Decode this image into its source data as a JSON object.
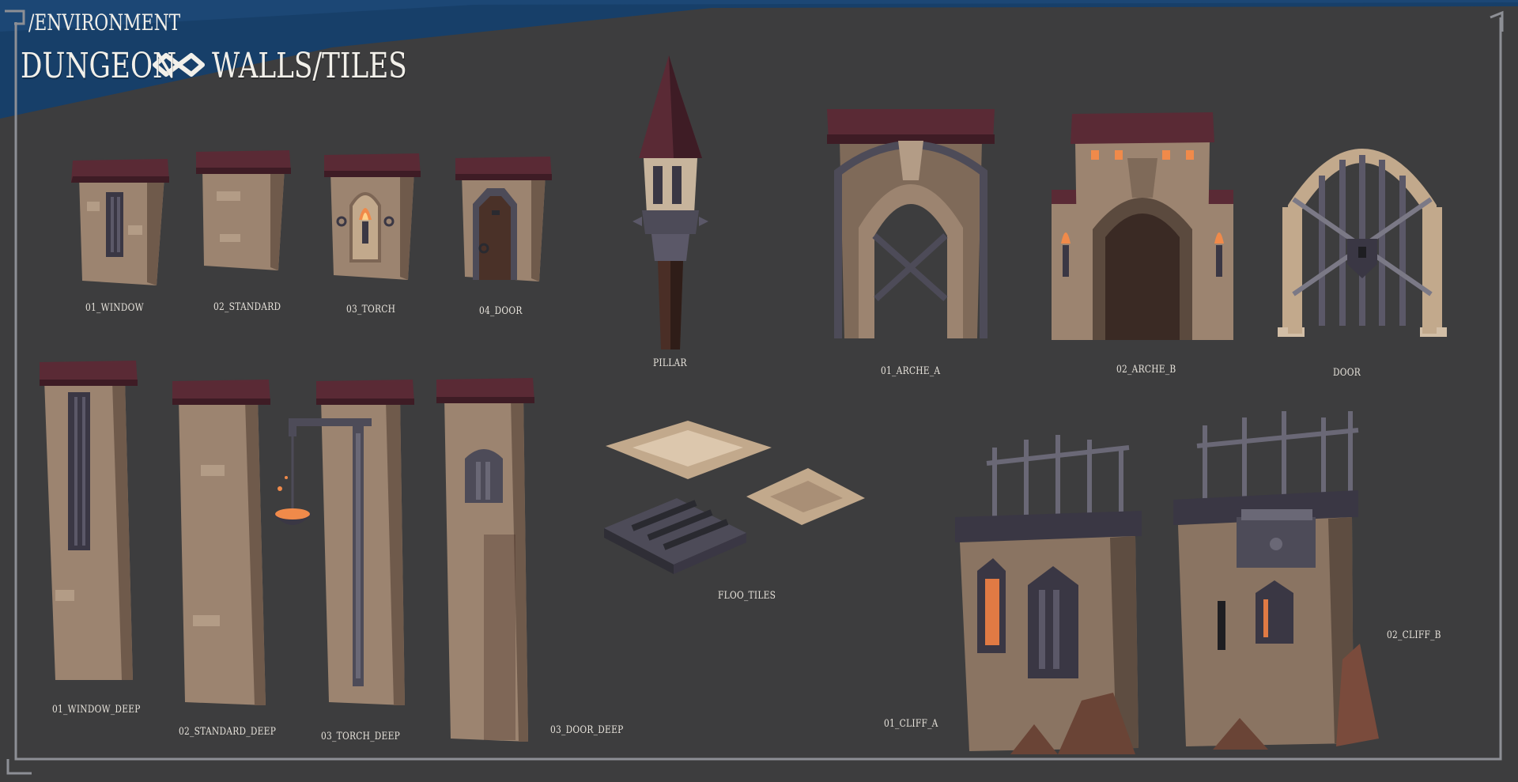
{
  "header": {
    "breadcrumb": "/ENVIRONMENT",
    "title_left": "DUNGEON",
    "title_right": "WALLS/TILES",
    "separator_icon": "infinity-icon"
  },
  "colors": {
    "background": "#3d3d3e",
    "banner": "#173f69",
    "roof": "#5a2a35",
    "stone": "#9c8470",
    "metal": "#4d4b58",
    "fire": "#f08a4a",
    "label": "#e8e4dc"
  },
  "labels": {
    "window": "01_WINDOW",
    "standard": "02_STANDARD",
    "torch": "03_TORCH",
    "door": "04_DOOR",
    "pillar": "PILLAR",
    "arche_a": "01_ARCHE_A",
    "arche_b": "02_ARCHE_B",
    "gate_door": "DOOR",
    "window_deep": "01_WINDOW_DEEP",
    "standard_deep": "02_STANDARD_DEEP",
    "torch_deep": "03_TORCH_DEEP",
    "door_deep": "03_DOOR_DEEP",
    "floor_tiles": "FLOO_TILES",
    "cliff_a": "01_CLIFF_A",
    "cliff_b": "02_CLIFF_B"
  }
}
